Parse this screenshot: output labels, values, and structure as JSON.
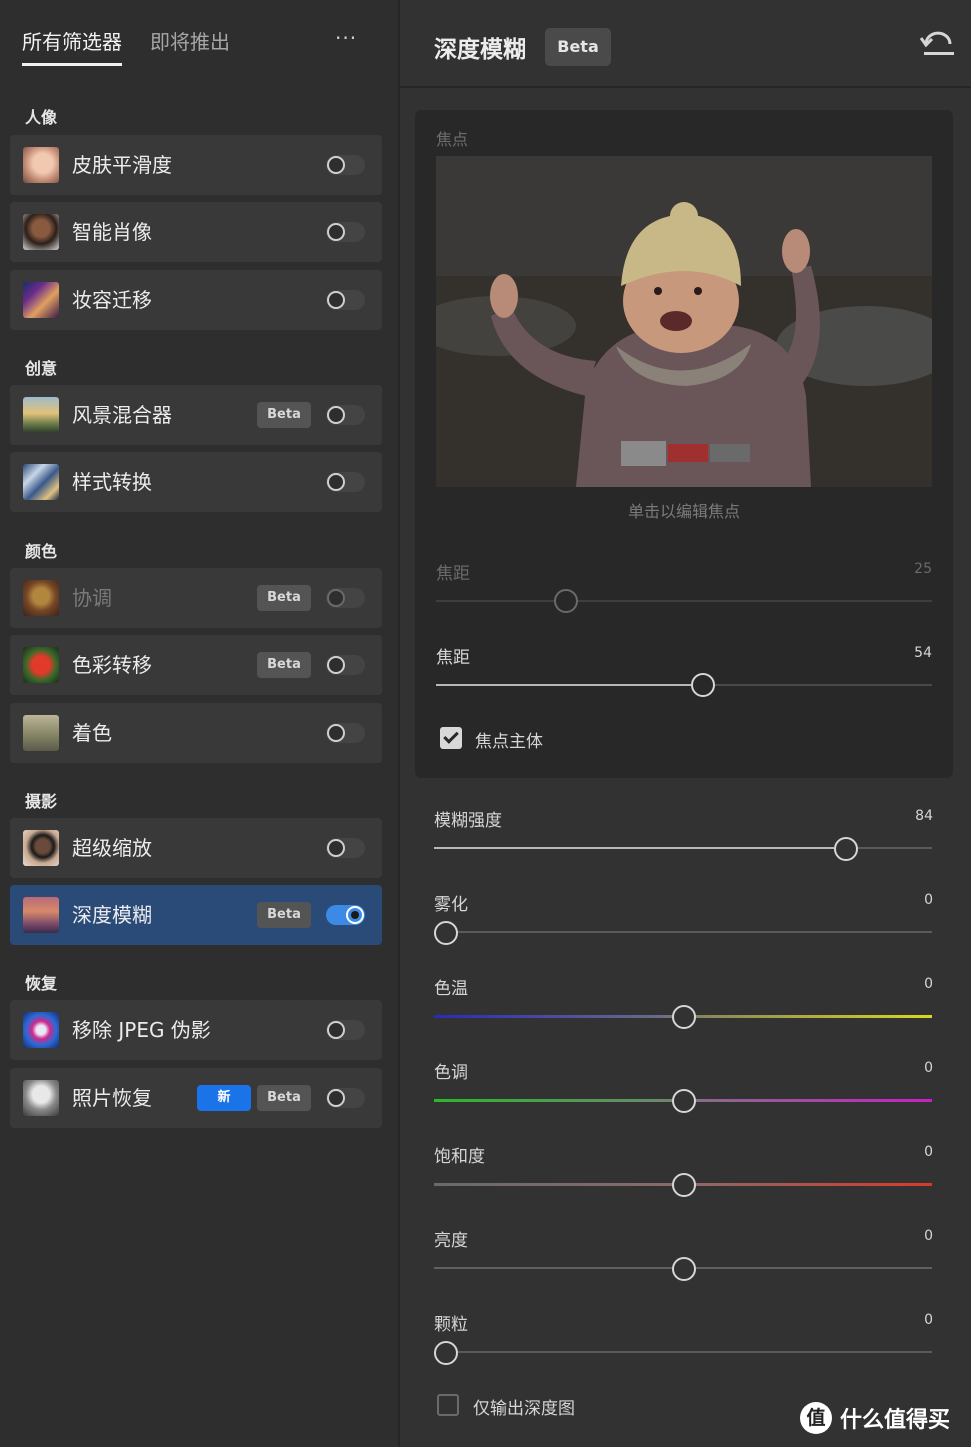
{
  "tabs": {
    "all": "所有筛选器",
    "coming": "即将推出",
    "more": "···"
  },
  "sections": {
    "portrait": "人像",
    "creative": "创意",
    "color": "颜色",
    "photo": "摄影",
    "restore": "恢复"
  },
  "filters": [
    {
      "name": "皮肤平滑度"
    },
    {
      "name": "智能肖像"
    },
    {
      "name": "妆容迁移"
    },
    {
      "name": "风景混合器",
      "badge": "Beta"
    },
    {
      "name": "样式转换"
    },
    {
      "name": "协调",
      "badge": "Beta"
    },
    {
      "name": "色彩转移",
      "badge": "Beta"
    },
    {
      "name": "着色"
    },
    {
      "name": "超级缩放"
    },
    {
      "name": "深度模糊",
      "badge": "Beta",
      "enabled": true
    },
    {
      "name": "移除 JPEG 伪影"
    },
    {
      "name": "照片恢复",
      "new": "新",
      "badge": "Beta"
    }
  ],
  "panel": {
    "title": "深度模糊",
    "beta": "Beta",
    "focus_label": "焦点",
    "focus_hint": "单击以编辑焦点",
    "focal_disabled": {
      "label": "焦距",
      "value": "25"
    },
    "focal": {
      "label": "焦距",
      "value": "54"
    },
    "focus_subject": "焦点主体",
    "blur": {
      "label": "模糊强度",
      "value": "84"
    },
    "haze": {
      "label": "雾化",
      "value": "0"
    },
    "temp": {
      "label": "色温",
      "value": "0"
    },
    "tint": {
      "label": "色调",
      "value": "0"
    },
    "saturation": {
      "label": "饱和度",
      "value": "0"
    },
    "brightness": {
      "label": "亮度",
      "value": "0"
    },
    "grain": {
      "label": "颗粒",
      "value": "0"
    },
    "depth_only": "仅输出深度图"
  },
  "watermark": {
    "icon": "值",
    "text": "什么值得买"
  }
}
